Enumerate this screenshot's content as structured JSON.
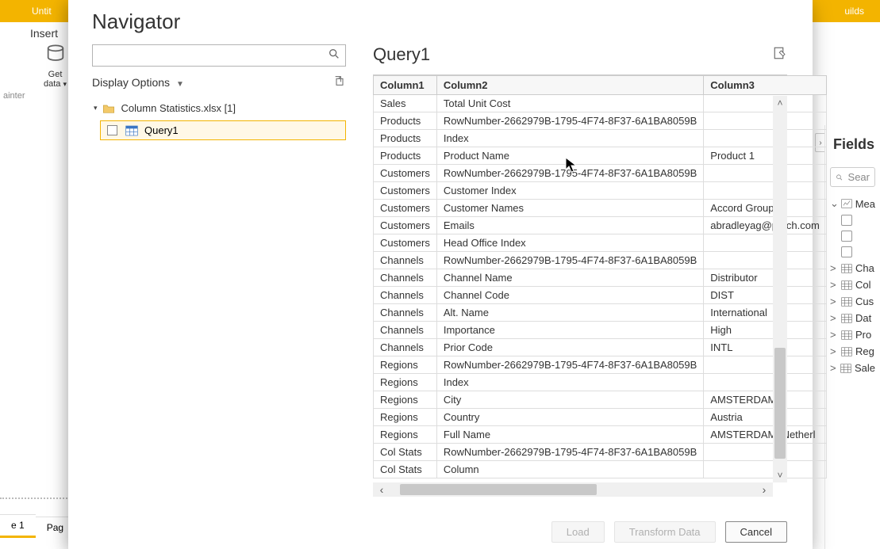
{
  "bg": {
    "title": "Untit",
    "insert_tab": "Insert",
    "getdata_line1": "Get",
    "getdata_line2": "data",
    "painter": "ainter",
    "tab1": "e 1",
    "tab2": "Pag",
    "builds": "uilds"
  },
  "fields": {
    "title": "Fields",
    "search_placeholder": "Sear",
    "items": [
      {
        "chev": "⌄",
        "label": "Mea",
        "type": "measure"
      },
      {
        "type": "checkbox"
      },
      {
        "type": "checkbox"
      },
      {
        "type": "checkbox"
      },
      {
        "chev": ">",
        "label": "Cha",
        "type": "table"
      },
      {
        "chev": ">",
        "label": "Col",
        "type": "table"
      },
      {
        "chev": ">",
        "label": "Cus",
        "type": "table"
      },
      {
        "chev": ">",
        "label": "Dat",
        "type": "table"
      },
      {
        "chev": ">",
        "label": "Pro",
        "type": "table"
      },
      {
        "chev": ">",
        "label": "Reg",
        "type": "table"
      },
      {
        "chev": ">",
        "label": "Sale",
        "type": "table"
      }
    ]
  },
  "dialog": {
    "title": "Navigator",
    "display_options": "Display Options",
    "tree_file": "Column Statistics.xlsx [1]",
    "tree_query": "Query1"
  },
  "preview": {
    "title": "Query1",
    "columns": [
      "Column1",
      "Column2",
      "Column3"
    ],
    "rows": [
      {
        "c1": "Sales",
        "c2": "Total Unit Cost",
        "c3": ""
      },
      {
        "c1": "Products",
        "c2": "RowNumber-2662979B-1795-4F74-8F37-6A1BA8059B",
        "c3": ""
      },
      {
        "c1": "Products",
        "c2": "Index",
        "c3": ""
      },
      {
        "c1": "Products",
        "c2": "Product Name",
        "c3": "Product 1"
      },
      {
        "c1": "Customers",
        "c2": "RowNumber-2662979B-1795-4F74-8F37-6A1BA8059B",
        "c3": ""
      },
      {
        "c1": "Customers",
        "c2": "Customer Index",
        "c3": ""
      },
      {
        "c1": "Customers",
        "c2": "Customer Names",
        "c3": "Accord Group"
      },
      {
        "c1": "Customers",
        "c2": "Emails",
        "c3": "abradleyag@patch.com"
      },
      {
        "c1": "Customers",
        "c2": "Head Office Index",
        "c3": ""
      },
      {
        "c1": "Channels",
        "c2": "RowNumber-2662979B-1795-4F74-8F37-6A1BA8059B",
        "c3": ""
      },
      {
        "c1": "Channels",
        "c2": "Channel Name",
        "c3": "Distributor"
      },
      {
        "c1": "Channels",
        "c2": "Channel Code",
        "c3": "DIST"
      },
      {
        "c1": "Channels",
        "c2": "Alt. Name",
        "c3": "International"
      },
      {
        "c1": "Channels",
        "c2": "Importance",
        "c3": "High"
      },
      {
        "c1": "Channels",
        "c2": "Prior Code",
        "c3": "INTL"
      },
      {
        "c1": "Regions",
        "c2": "RowNumber-2662979B-1795-4F74-8F37-6A1BA8059B",
        "c3": ""
      },
      {
        "c1": "Regions",
        "c2": "Index",
        "c3": ""
      },
      {
        "c1": "Regions",
        "c2": "City",
        "c3": "AMSTERDAM"
      },
      {
        "c1": "Regions",
        "c2": "Country",
        "c3": "Austria"
      },
      {
        "c1": "Regions",
        "c2": "Full Name",
        "c3": "AMSTERDAM, Netherl"
      },
      {
        "c1": "Col Stats",
        "c2": "RowNumber-2662979B-1795-4F74-8F37-6A1BA8059B",
        "c3": ""
      },
      {
        "c1": "Col Stats",
        "c2": "Column",
        "c3": ""
      }
    ]
  },
  "buttons": {
    "load": "Load",
    "transform": "Transform Data",
    "cancel": "Cancel"
  }
}
